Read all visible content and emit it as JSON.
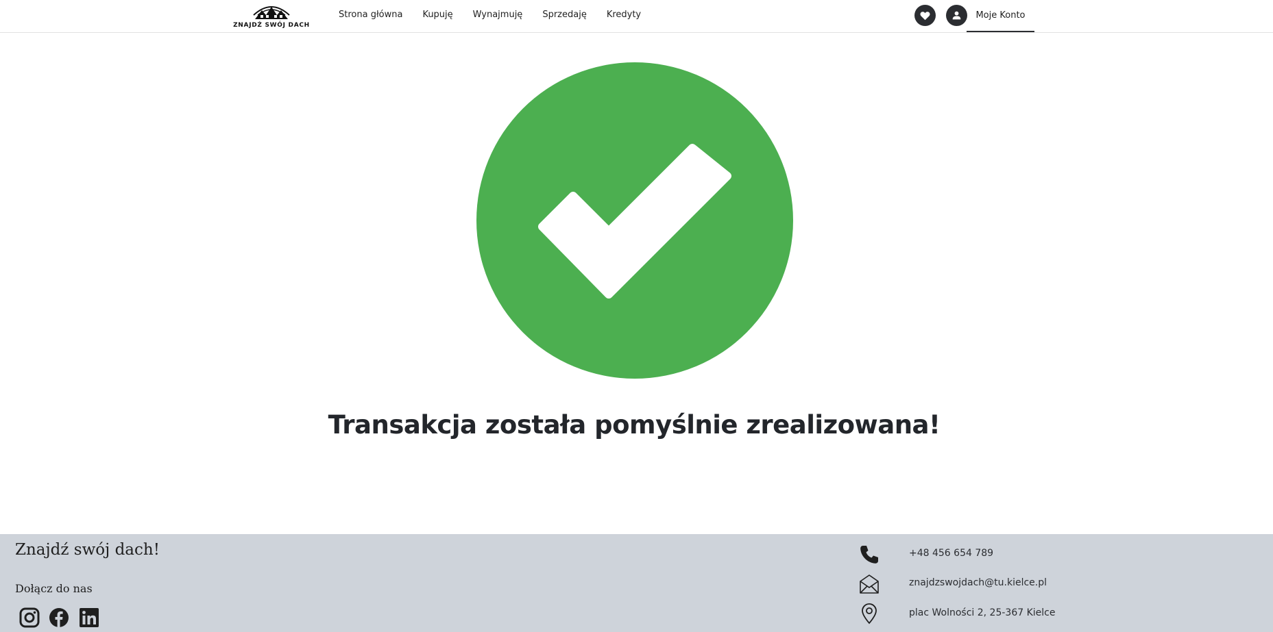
{
  "header": {
    "logo_text": "ZNAJDŹ SWÓJ DACH",
    "nav": [
      "Strona główna",
      "Kupuję",
      "Wynajmuję",
      "Sprzedaję",
      "Kredyty"
    ],
    "favorites_icon": "heart-icon",
    "user_icon": "user-icon",
    "account_label": "Moje Konto"
  },
  "main": {
    "status_icon": "check-circle-icon",
    "status_color": "#4caf50",
    "message": "Transakcja została pomyślnie zrealizowana!"
  },
  "footer": {
    "brand": "Znajdź swój dach!",
    "join_label": "Dołącz do nas",
    "social": [
      "instagram-icon",
      "facebook-icon",
      "linkedin-icon"
    ],
    "phone": "+48 456 654 789",
    "email": "znajdzswojdach@tu.kielce.pl",
    "address": "plac Wolności 2, 25-367 Kielce",
    "background": "#ced3da"
  }
}
